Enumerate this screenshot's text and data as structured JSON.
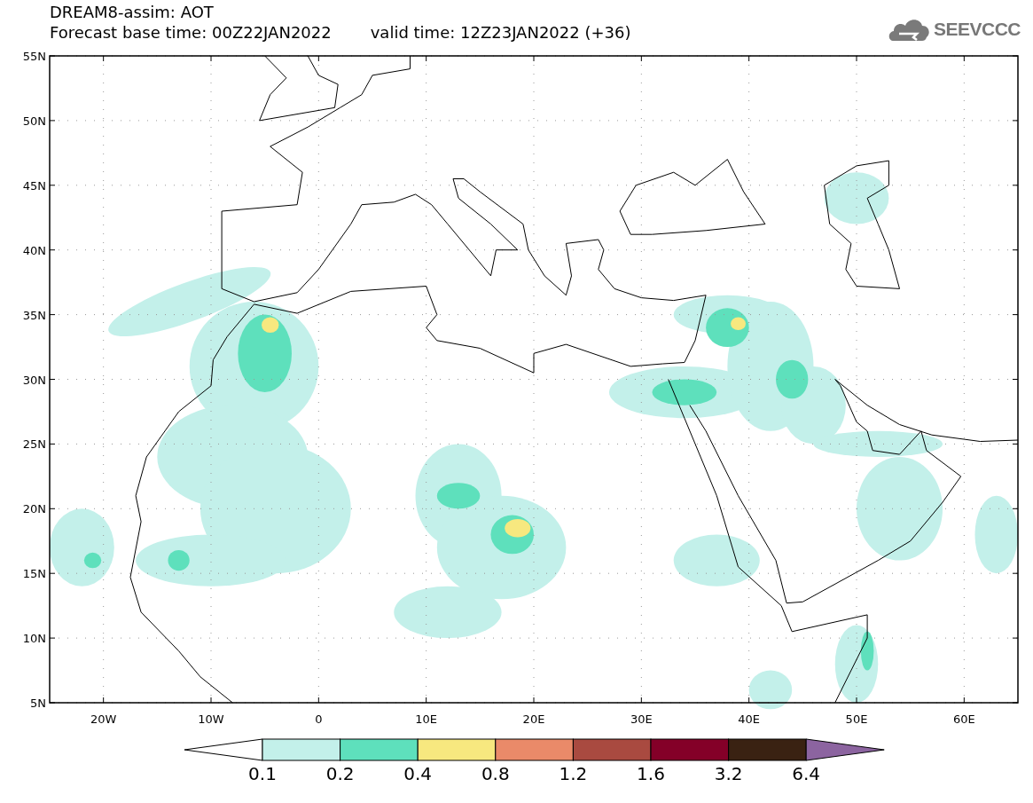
{
  "header": {
    "title": "DREAM8-assim: AOT",
    "base_time": "Forecast base time: 00Z22JAN2022",
    "valid_time": "valid time: 12Z23JAN2022 (+36)",
    "logo_text": "SEEVCCC"
  },
  "map": {
    "lat_labels": [
      "55N",
      "50N",
      "45N",
      "40N",
      "35N",
      "30N",
      "25N",
      "20N",
      "15N",
      "10N",
      "5N"
    ],
    "lon_labels": [
      "20W",
      "10W",
      "0",
      "10E",
      "20E",
      "30E",
      "40E",
      "50E",
      "60E"
    ]
  },
  "colorbar": {
    "bins": [
      {
        "kind": "low_arrow",
        "color": "#ffffff"
      },
      {
        "kind": "swatch",
        "color": "#c3f0ea"
      },
      {
        "kind": "swatch",
        "color": "#5ee0bc"
      },
      {
        "kind": "swatch",
        "color": "#f7e87f"
      },
      {
        "kind": "swatch",
        "color": "#ea8a69"
      },
      {
        "kind": "swatch",
        "color": "#a94a40"
      },
      {
        "kind": "swatch",
        "color": "#840028"
      },
      {
        "kind": "swatch",
        "color": "#3a2212"
      },
      {
        "kind": "high_arrow",
        "color": "#8c64a0"
      }
    ],
    "labels": [
      "0.1",
      "0.2",
      "0.4",
      "0.8",
      "1.2",
      "1.6",
      "3.2",
      "6.4"
    ]
  }
}
